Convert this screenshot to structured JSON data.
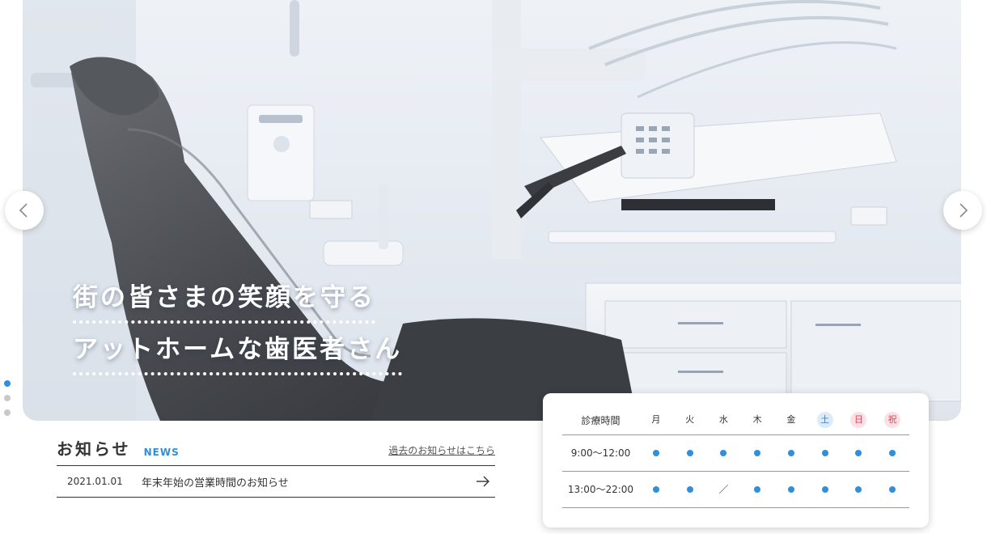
{
  "hero": {
    "catch_line_1": "街の皆さまの笑顔を守る",
    "catch_line_2": "アットホームな歯医者さん",
    "slide_dots": 3,
    "active_slide": 1
  },
  "news": {
    "title": "お知らせ",
    "subtitle": "NEWS",
    "more_link": "過去のお知らせはこちら",
    "items": [
      {
        "date": "2021.01.01",
        "text": "年末年始の営業時間のお知らせ"
      }
    ]
  },
  "schedule": {
    "header_label": "診療時間",
    "days": [
      {
        "label": "月",
        "badge": null,
        "text_color": "#333333"
      },
      {
        "label": "火",
        "badge": null,
        "text_color": "#333333"
      },
      {
        "label": "水",
        "badge": null,
        "text_color": "#333333"
      },
      {
        "label": "木",
        "badge": null,
        "text_color": "#333333"
      },
      {
        "label": "金",
        "badge": null,
        "text_color": "#333333"
      },
      {
        "label": "土",
        "badge": "#dcebf8",
        "text_color": "#2f7fc8"
      },
      {
        "label": "日",
        "badge": "#fbe1e4",
        "text_color": "#d9455a"
      },
      {
        "label": "祝",
        "badge": "#fbe1e4",
        "text_color": "#d9455a"
      }
    ],
    "rows": [
      {
        "time": "9:00〜12:00",
        "cells": [
          "open",
          "open",
          "open",
          "open",
          "open",
          "open",
          "open",
          "open"
        ]
      },
      {
        "time": "13:00〜22:00",
        "cells": [
          "open",
          "open",
          "／",
          "open",
          "open",
          "open",
          "open",
          "open"
        ]
      }
    ]
  },
  "colors": {
    "accent": "#2f8fdc",
    "text": "#333333"
  }
}
